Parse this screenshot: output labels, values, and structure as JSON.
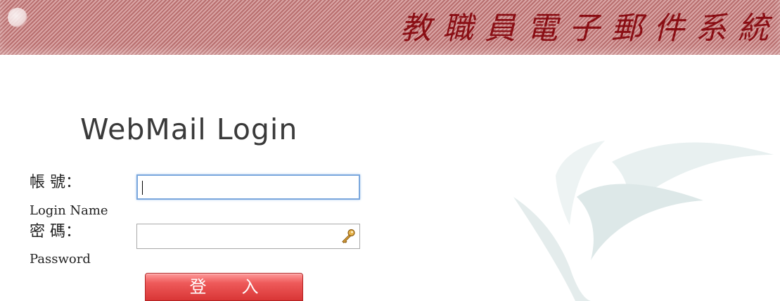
{
  "header": {
    "title": "教職員電子郵件系統"
  },
  "login": {
    "heading": "WebMail Login",
    "username_label": "帳 號：",
    "username_sublabel": "Login Name",
    "username_value": "",
    "password_label": "密 碼：",
    "password_sublabel": "Password",
    "password_value": "",
    "submit_label": "登入"
  },
  "icons": {
    "password_field_icon": "key-icon",
    "banner_decoration": "orb-highlight",
    "watermark": "swoosh-logo-watermark"
  },
  "colors": {
    "banner_stripes_light": "#d9a5a5",
    "banner_stripes_dark": "#b86e6e",
    "banner_title": "#8a0e14",
    "button_top": "#ff9b9b",
    "button_bottom": "#d93636",
    "input_focus_border": "#7aa7dd",
    "watermark": "#e6eeee"
  }
}
